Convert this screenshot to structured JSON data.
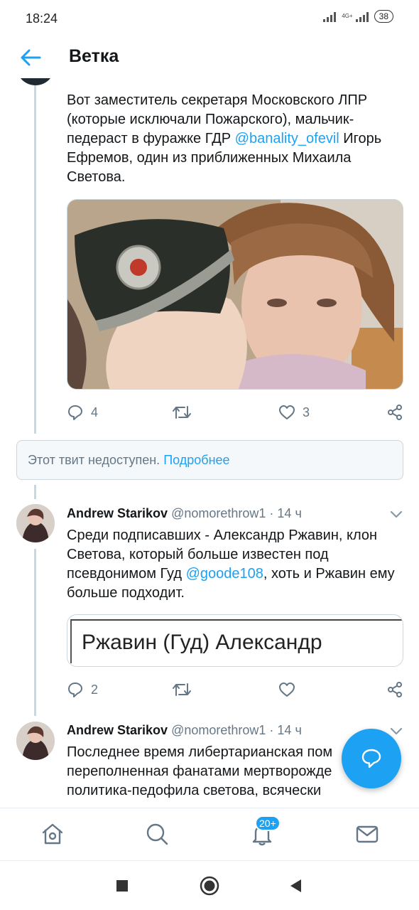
{
  "status_bar": {
    "time": "18:24",
    "network": "4G+",
    "battery": "38"
  },
  "header": {
    "title": "Ветка"
  },
  "tweet1": {
    "text_parts": [
      "Вот заместитель секретаря Московского ЛПР (которые исключали Пожарского), мальчик-педераст в фуражке ГДР ",
      "@banality_ofevil",
      " Игорь Ефремов, один из приближенных Михаила Светова."
    ],
    "replies": "4",
    "likes": "3"
  },
  "unavailable": {
    "text": "Этот твит недоступен.",
    "link": "Подробнее"
  },
  "tweet2": {
    "name": "Andrew Starikov",
    "handle": "@nomorethrow1",
    "time": "· 14 ч",
    "text_parts": [
      "Среди подписавших - Александр Ржавин, клон Светова, который больше известен под псевдонимом Гуд ",
      "@goode108",
      ", хоть и Ржавин ему больше подходит."
    ],
    "card_text": "Ржавин (Гуд) Александр",
    "replies": "2",
    "likes": ""
  },
  "tweet3": {
    "name": "Andrew Starikov",
    "handle": "@nomorethrow1",
    "time": "· 14 ч",
    "text": "Последнее время либертарианская пом переполненная фанатами мертворожде политика-педофила светова, всячески"
  },
  "bottom_nav": {
    "notifications_badge": "20+"
  },
  "colors": {
    "accent": "#1da1f2",
    "secondary_text": "#657786",
    "border": "#ccd6dd"
  }
}
